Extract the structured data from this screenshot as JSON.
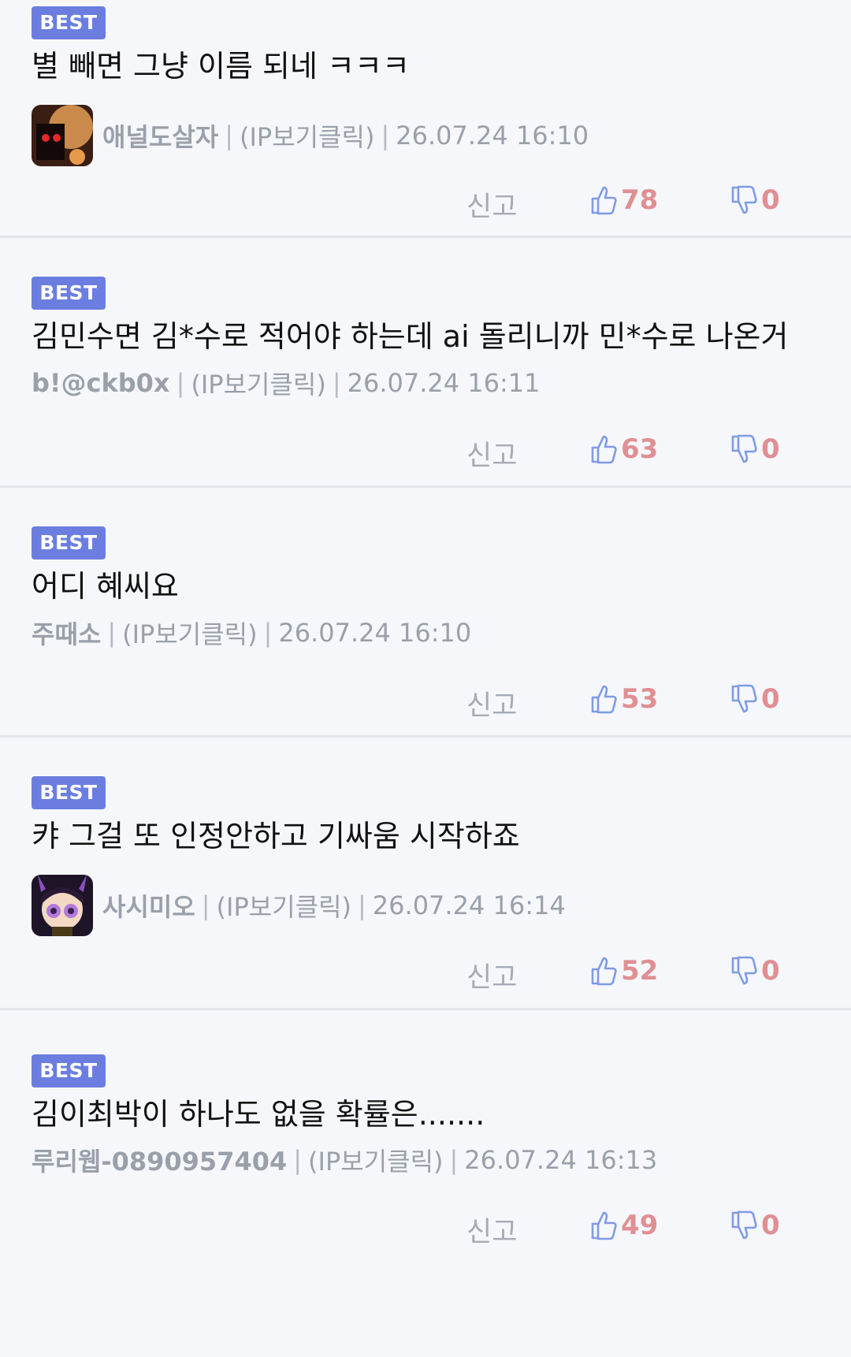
{
  "comments": [
    {
      "badge": "BEST",
      "text": "별 빼면 그냥 이름 되네 ㅋㅋㅋ",
      "nick": "애널도살자",
      "ip": "(IP보기클릭)",
      "time": "26.07.24 16:10",
      "report": "신고",
      "likes": "78",
      "dislikes": "0",
      "avatar": "avatar-1"
    },
    {
      "badge": "BEST",
      "text": "김민수면 김*수로 적어야 하는데 ai 돌리니까 민*수로 나온거",
      "nick": "b!@ckb0x",
      "ip": "(IP보기클릭)",
      "time": "26.07.24 16:11",
      "report": "신고",
      "likes": "63",
      "dislikes": "0"
    },
    {
      "badge": "BEST",
      "text": "어디 혜씨요",
      "nick": "주때소",
      "ip": "(IP보기클릭)",
      "time": "26.07.24 16:10",
      "report": "신고",
      "likes": "53",
      "dislikes": "0"
    },
    {
      "badge": "BEST",
      "text": "캬 그걸 또 인정안하고 기싸움 시작하죠",
      "nick": "사시미오",
      "ip": "(IP보기클릭)",
      "time": "26.07.24 16:14",
      "report": "신고",
      "likes": "52",
      "dislikes": "0",
      "avatar": "avatar-2"
    },
    {
      "badge": "BEST",
      "text": "김이최박이 하나도 없을 확률은.......",
      "nick": "루리웹-0890957404",
      "ip": "(IP보기클릭)",
      "time": "26.07.24 16:13",
      "report": "신고",
      "likes": "49",
      "dislikes": "0"
    }
  ],
  "separator": "|",
  "colors": {
    "badge": "#6b7ee0",
    "like": "#e08f93",
    "thumb": "#7f9be6",
    "background": "#f6f7fb"
  }
}
